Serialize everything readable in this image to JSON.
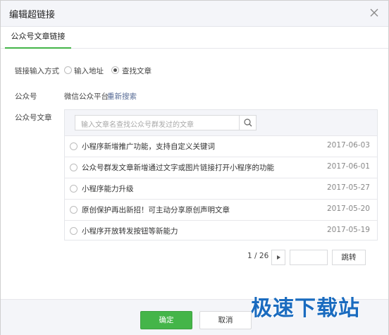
{
  "dialog": {
    "title": "编辑超链接",
    "close_icon": "close-icon"
  },
  "tabs": [
    {
      "label": "公众号文章链接",
      "active": true
    }
  ],
  "link_method": {
    "label": "链接输入方式",
    "options": [
      {
        "label": "输入地址",
        "checked": false
      },
      {
        "label": "查找文章",
        "checked": true
      }
    ]
  },
  "account": {
    "label": "公众号",
    "value": "微信公众平台",
    "research_link": "重新搜索"
  },
  "articles": {
    "label": "公众号文章",
    "search_placeholder": "输入文章名查找公众号群发过的文章",
    "search_icon": "search-icon",
    "items": [
      {
        "title": "小程序新增推广功能，支持自定义关键词",
        "date": "2017-06-03"
      },
      {
        "title": "公众号群发文章新增通过文字或图片链接打开小程序的功能",
        "date": "2017-06-01"
      },
      {
        "title": "小程序能力升级",
        "date": "2017-05-27"
      },
      {
        "title": "原创保护再出新招！可主动分享原创声明文章",
        "date": "2017-05-20"
      },
      {
        "title": "小程序开放转发按钮等新能力",
        "date": "2017-05-19"
      }
    ]
  },
  "pagination": {
    "current": "1 / 26",
    "next_icon": "triangle-right-icon",
    "jump_label": "跳转",
    "page_input_value": ""
  },
  "footer": {
    "ok_label": "确定",
    "cancel_label": "取消"
  },
  "watermark": "极速下载站",
  "colors": {
    "accent": "#44b549",
    "link": "#576b95",
    "header_bg": "#f4f5f9",
    "watermark": "#1a6bbf"
  }
}
